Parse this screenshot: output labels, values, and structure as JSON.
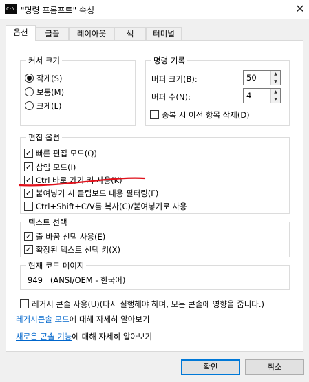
{
  "window": {
    "title": "\"명령 프롬프트\" 속성",
    "icon": "cmd-icon",
    "icon_text": "C:\\."
  },
  "tabs": [
    {
      "label": "옵션",
      "active": true
    },
    {
      "label": "글꼴",
      "active": false
    },
    {
      "label": "레이아웃",
      "active": false
    },
    {
      "label": "색",
      "active": false
    },
    {
      "label": "터미널",
      "active": false
    }
  ],
  "cursor_size": {
    "title": "커서 크기",
    "options": [
      {
        "label": "작게(S)",
        "selected": true
      },
      {
        "label": "보통(M)",
        "selected": false
      },
      {
        "label": "크게(L)",
        "selected": false
      }
    ]
  },
  "command_history": {
    "title": "명령 기록",
    "buffer_size_label": "버퍼 크기(B):",
    "buffer_size_value": "50",
    "buffer_count_label": "버퍼 수(N):",
    "buffer_count_value": "4",
    "discard_duplicates_label": "중복 시 이전 항목 삭제(D)",
    "discard_duplicates_checked": false
  },
  "edit_options": {
    "title": "편집 옵션",
    "items": [
      {
        "label": "빠른 편집 모드(Q)",
        "checked": true
      },
      {
        "label": "삽입 모드(I)",
        "checked": true
      },
      {
        "label": "Ctrl 바로 가기 키 사용(K)",
        "checked": true
      },
      {
        "label": "붙여넣기 시 클립보드 내용 필터링(F)",
        "checked": true
      },
      {
        "label": "Ctrl+Shift+C/V를 복사(C)/붙여넣기로 사용",
        "checked": false
      }
    ]
  },
  "text_selection": {
    "title": "텍스트 선택",
    "items": [
      {
        "label": "줄 바꿈 선택 사용(E)",
        "checked": true
      },
      {
        "label": "확장된 텍스트 선택 키(X)",
        "checked": true
      }
    ]
  },
  "code_page": {
    "title": "현재 코드 페이지",
    "value": "949   (ANSI/OEM - 한국어)"
  },
  "legacy": {
    "label": "레거시 콘솔 사용(U)(다시 실행해야 하며, 모든 콘솔에 영향을 줍니다.)",
    "checked": false,
    "link1_text": "레거시콘솔 모드",
    "link1_suffix": "에 대해 자세히 알아보기",
    "link2_text": "새로운 콘솔 기능",
    "link2_suffix": "에 대해 자세히 알아보기"
  },
  "buttons": {
    "ok": "확인",
    "cancel": "취소"
  },
  "annotation": {
    "color": "#e0101a"
  }
}
